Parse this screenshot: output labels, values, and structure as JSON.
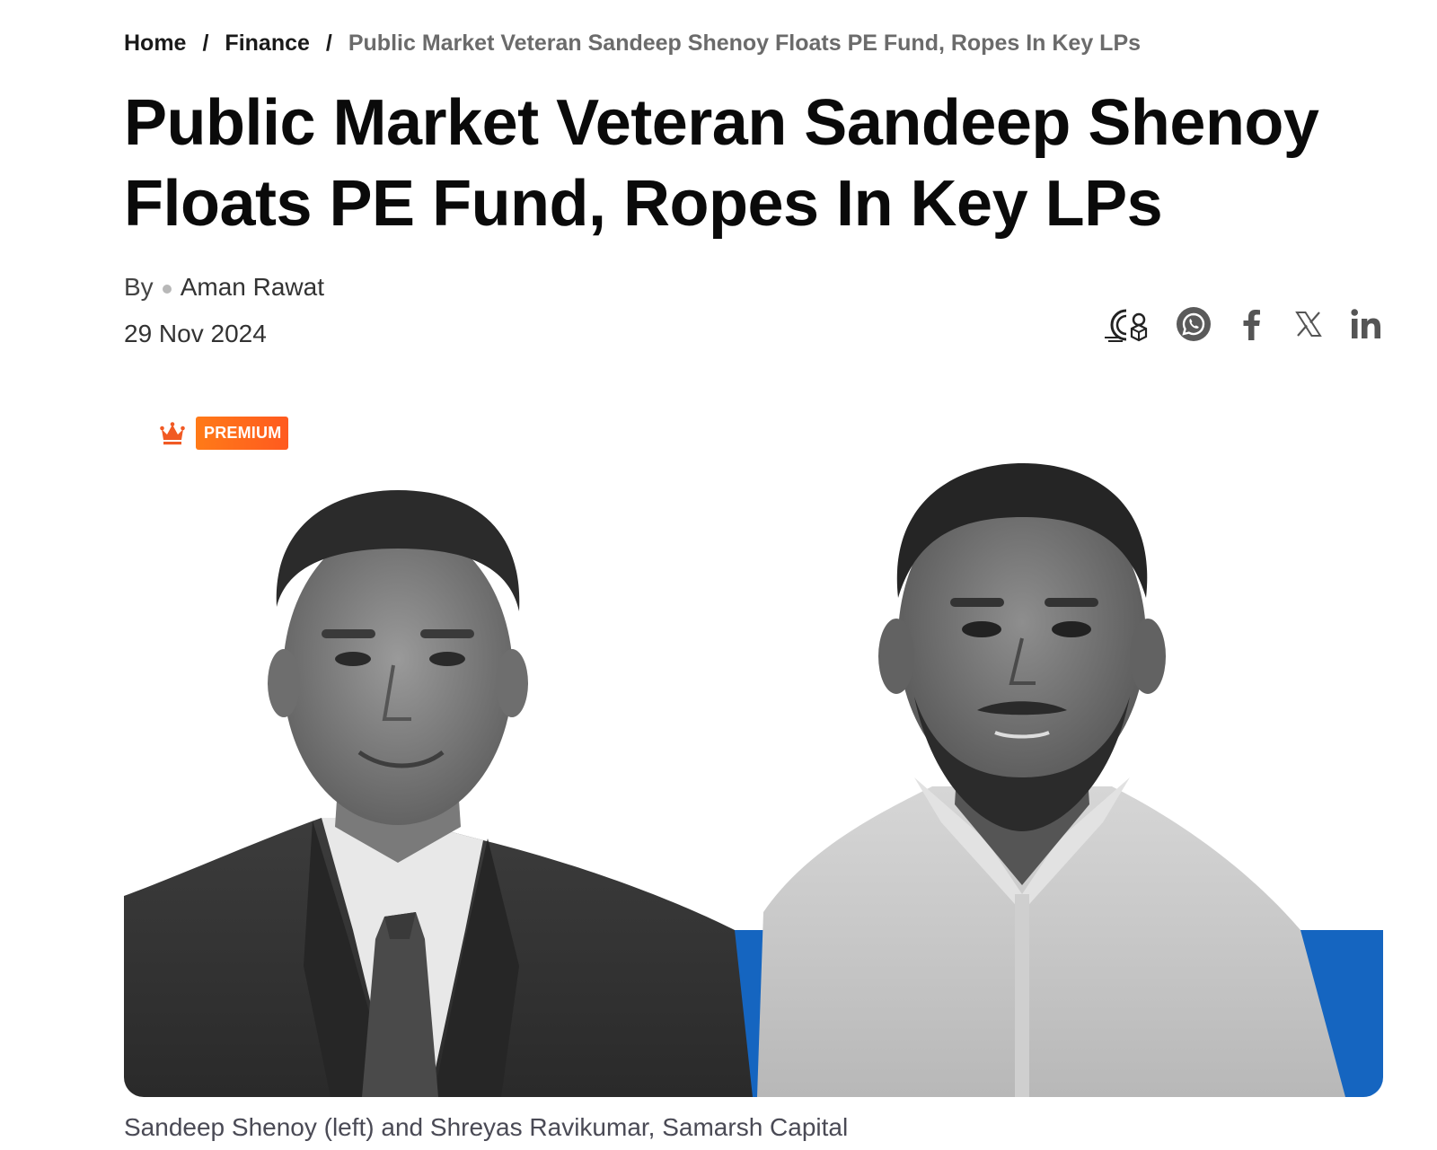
{
  "breadcrumb": {
    "home": "Home",
    "section": "Finance",
    "current": "Public Market Veteran Sandeep Shenoy Floats PE Fund, Ropes In Key LPs",
    "separator": "/"
  },
  "article": {
    "headline": "Public Market Veteran Sandeep Shenoy Floats PE Fund, Ropes In Key LPs",
    "by_label": "By",
    "author": "Aman Rawat",
    "date": "29 Nov 2024",
    "badge": "PREMIUM",
    "caption": "Sandeep Shenoy (left) and Shreyas Ravikumar, Samarsh Capital"
  },
  "share": {
    "icons": [
      "listen-icon",
      "whatsapp-icon",
      "facebook-icon",
      "x-icon",
      "linkedin-icon"
    ]
  },
  "colors": {
    "badge": "#ff6a1a",
    "crown": "#f15a24",
    "accent_blue": "#1565c0",
    "caption": "#4a4a55",
    "breadcrumb_current": "#6b6b6b"
  }
}
